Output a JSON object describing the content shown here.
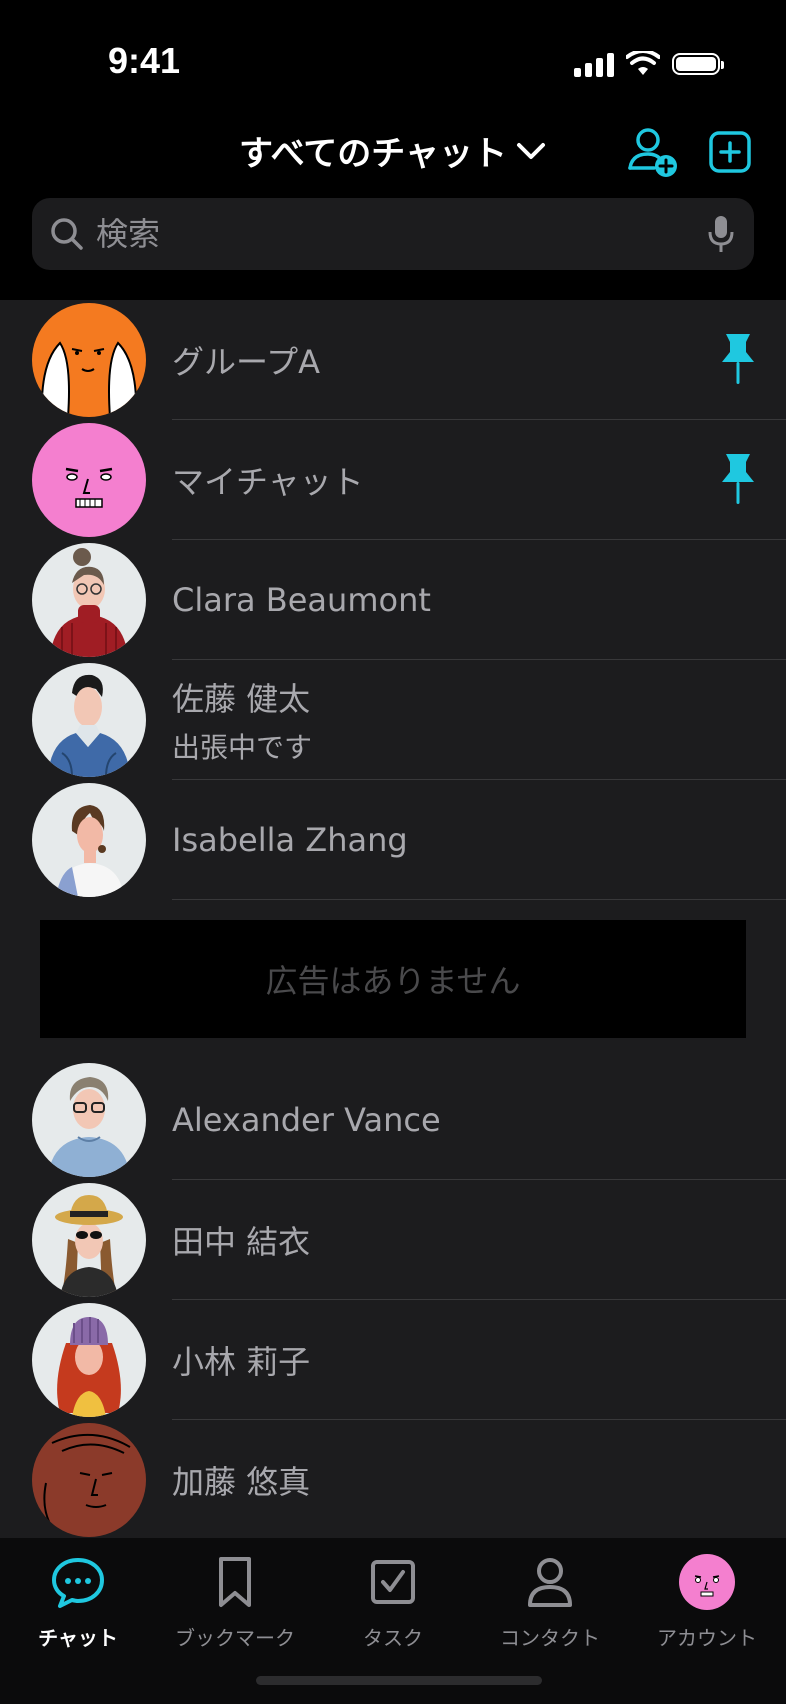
{
  "status": {
    "time": "9:41"
  },
  "header": {
    "title": "すべてのチャット"
  },
  "search": {
    "placeholder": "検索"
  },
  "chats": [
    {
      "name": "グループA",
      "pinned": true
    },
    {
      "name": "マイチャット",
      "pinned": true
    },
    {
      "name": "Clara Beaumont"
    },
    {
      "name": "佐藤 健太",
      "subtitle": "出張中です"
    },
    {
      "name": "Isabella Zhang"
    },
    {
      "name": "Alexander Vance"
    },
    {
      "name": "田中 結衣"
    },
    {
      "name": "小林 莉子"
    },
    {
      "name": "加藤 悠真"
    }
  ],
  "ad": {
    "text": "広告はありません"
  },
  "tabs": [
    {
      "label": "チャット",
      "active": true
    },
    {
      "label": "ブックマーク"
    },
    {
      "label": "タスク"
    },
    {
      "label": "コンタクト"
    },
    {
      "label": "アカウント"
    }
  ],
  "colors": {
    "accent": "#1fc8e0",
    "background": "#1c1c1e",
    "header_bg": "#000000"
  }
}
